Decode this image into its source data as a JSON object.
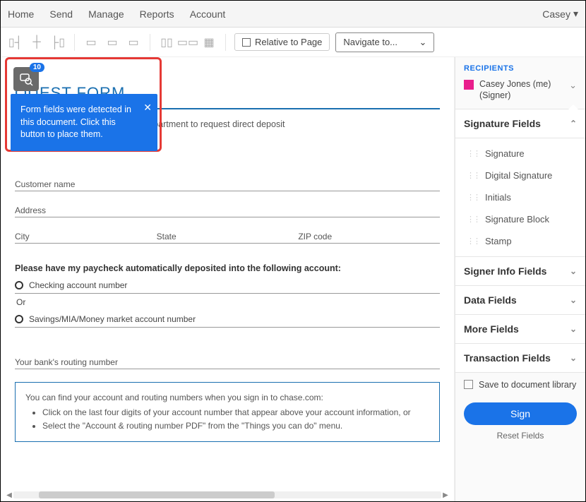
{
  "topnav": {
    "items": [
      "Home",
      "Send",
      "Manage",
      "Reports",
      "Account"
    ],
    "user": "Casey"
  },
  "toolbar": {
    "relative": "Relative to Page",
    "navigate": "Navigate to..."
  },
  "detect": {
    "count": "10",
    "tooltip": "Form fields were detected in this document. Click this button to place them."
  },
  "doc": {
    "title": "QUEST FORM",
    "intro": "take it to your employer's payroll department to request direct deposit",
    "fields": {
      "customer": "Customer name",
      "address": "Address",
      "city": "City",
      "state": "State",
      "zip": "ZIP code"
    },
    "section": "Please have my paycheck automatically deposited into the following account:",
    "checking": "Checking account number",
    "or": "Or",
    "savings": "Savings/MIA/Money market account number",
    "routing": "Your bank's routing number",
    "inst_head": "You can find your account and routing numbers when you sign in to chase.com:",
    "inst_1": "Click on the last four digits of your account number that appear above your account information, or",
    "inst_2": "Select the \"Account & routing number PDF\" from the \"Things you can do\" menu."
  },
  "sidebar": {
    "recipients_label": "RECIPIENTS",
    "recipient_name": "Casey Jones (me)",
    "recipient_role": "(Signer)",
    "sections": {
      "sig": "Signature Fields",
      "signer": "Signer Info Fields",
      "data": "Data Fields",
      "more": "More Fields",
      "trans": "Transaction Fields"
    },
    "sig_items": [
      "Signature",
      "Digital Signature",
      "Initials",
      "Signature Block",
      "Stamp"
    ],
    "save_lib": "Save to document library",
    "sign": "Sign",
    "reset": "Reset Fields"
  }
}
